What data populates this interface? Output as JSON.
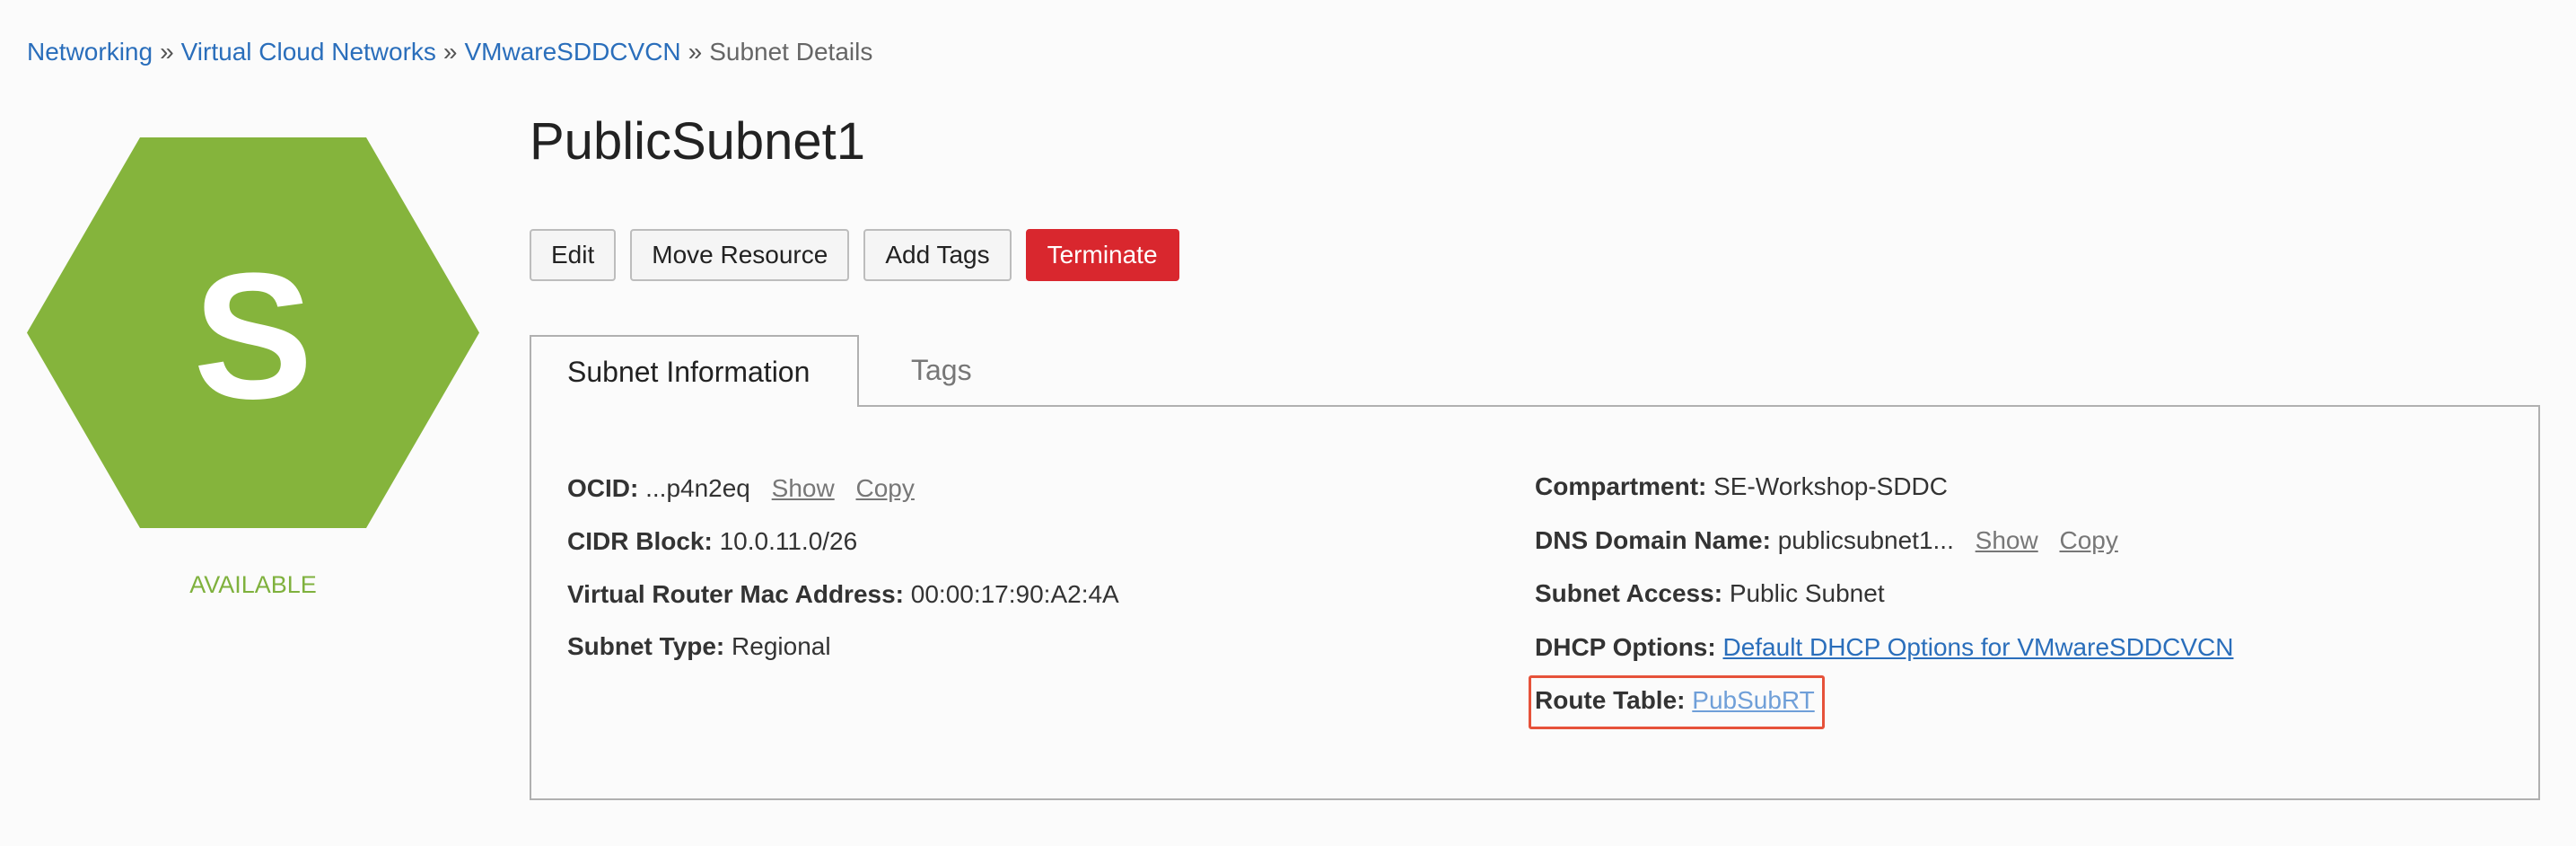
{
  "breadcrumb": {
    "items": [
      {
        "label": "Networking"
      },
      {
        "label": "Virtual Cloud Networks"
      },
      {
        "label": "VMwareSDDCVCN"
      }
    ],
    "separator": "»",
    "current": "Subnet Details"
  },
  "resource": {
    "icon_letter": "S",
    "icon_color": "#85b43c",
    "status": "AVAILABLE",
    "status_color": "#7fb13d",
    "title": "PublicSubnet1"
  },
  "actions": {
    "edit": "Edit",
    "move": "Move Resource",
    "add_tags": "Add Tags",
    "terminate": "Terminate"
  },
  "tabs": [
    {
      "label": "Subnet Information",
      "active": true
    },
    {
      "label": "Tags",
      "active": false
    }
  ],
  "details": {
    "left": {
      "ocid": {
        "label": "OCID:",
        "value": "...p4n2eq",
        "show": "Show",
        "copy": "Copy"
      },
      "cidr": {
        "label": "CIDR Block:",
        "value": "10.0.11.0/26"
      },
      "mac": {
        "label": "Virtual Router Mac Address:",
        "value": "00:00:17:90:A2:4A"
      },
      "type": {
        "label": "Subnet Type:",
        "value": "Regional"
      }
    },
    "right": {
      "compartment": {
        "label": "Compartment:",
        "value": "SE-Workshop-SDDC"
      },
      "dns": {
        "label": "DNS Domain Name:",
        "value": "publicsubnet1...",
        "show": "Show",
        "copy": "Copy"
      },
      "access": {
        "label": "Subnet Access:",
        "value": "Public Subnet"
      },
      "dhcp": {
        "label": "DHCP Options:",
        "value": "Default DHCP Options for VMwareSDDCVCN"
      },
      "route": {
        "label": "Route Table:",
        "value": "PubSubRT"
      }
    }
  },
  "colors": {
    "link": "#2a6ebb",
    "danger": "#d9272e",
    "highlight": "#e6523a"
  }
}
